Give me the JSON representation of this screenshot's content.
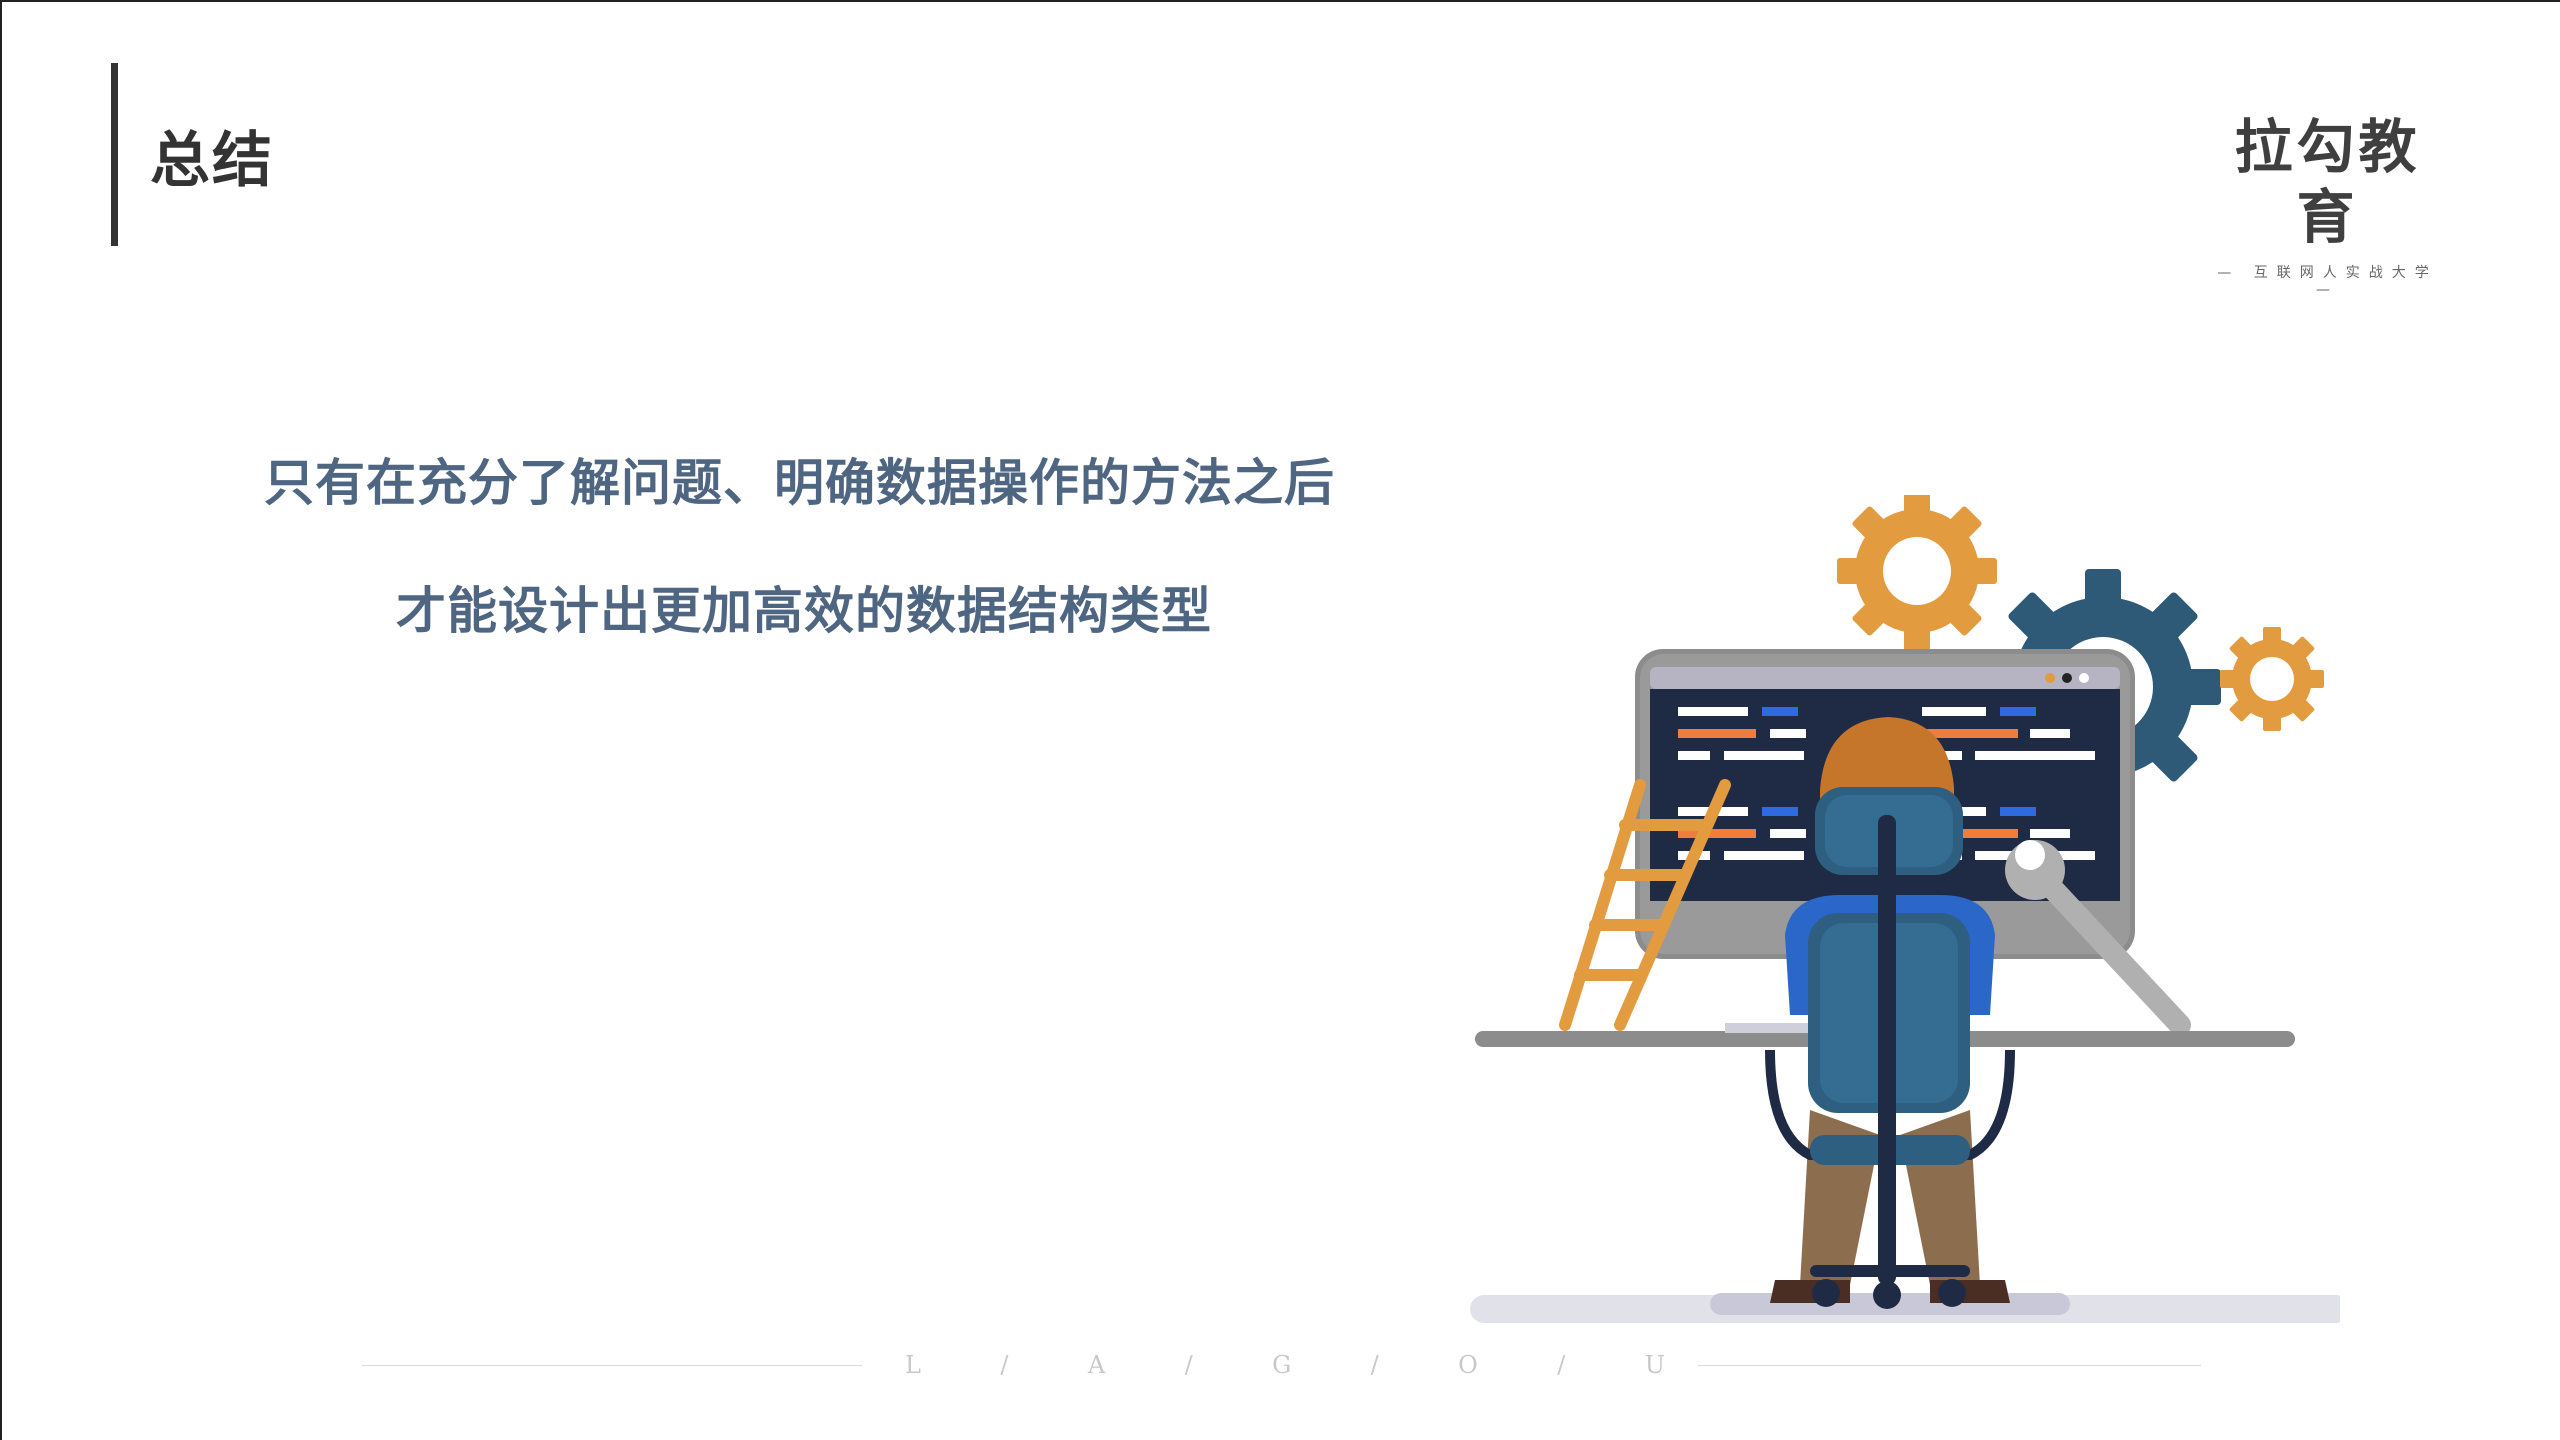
{
  "slide": {
    "title": "总结",
    "body_line_1": "只有在充分了解问题、明确数据操作的方法之后",
    "body_line_2": "才能设计出更加高效的数据结构类型"
  },
  "logo": {
    "name": "拉勾教育",
    "tagline": "— 互联网人实战大学 —"
  },
  "footer": {
    "letters": [
      "L",
      "/",
      "A",
      "/",
      "G",
      "/",
      "O",
      "/",
      "U"
    ]
  },
  "colors": {
    "body_text": "#4f6682",
    "title_text": "#333333",
    "gear_orange": "#e39b3f",
    "gear_blue": "#2e5a77",
    "screen_dark": "#1f2b45",
    "chair_blue": "#2e5f80"
  }
}
